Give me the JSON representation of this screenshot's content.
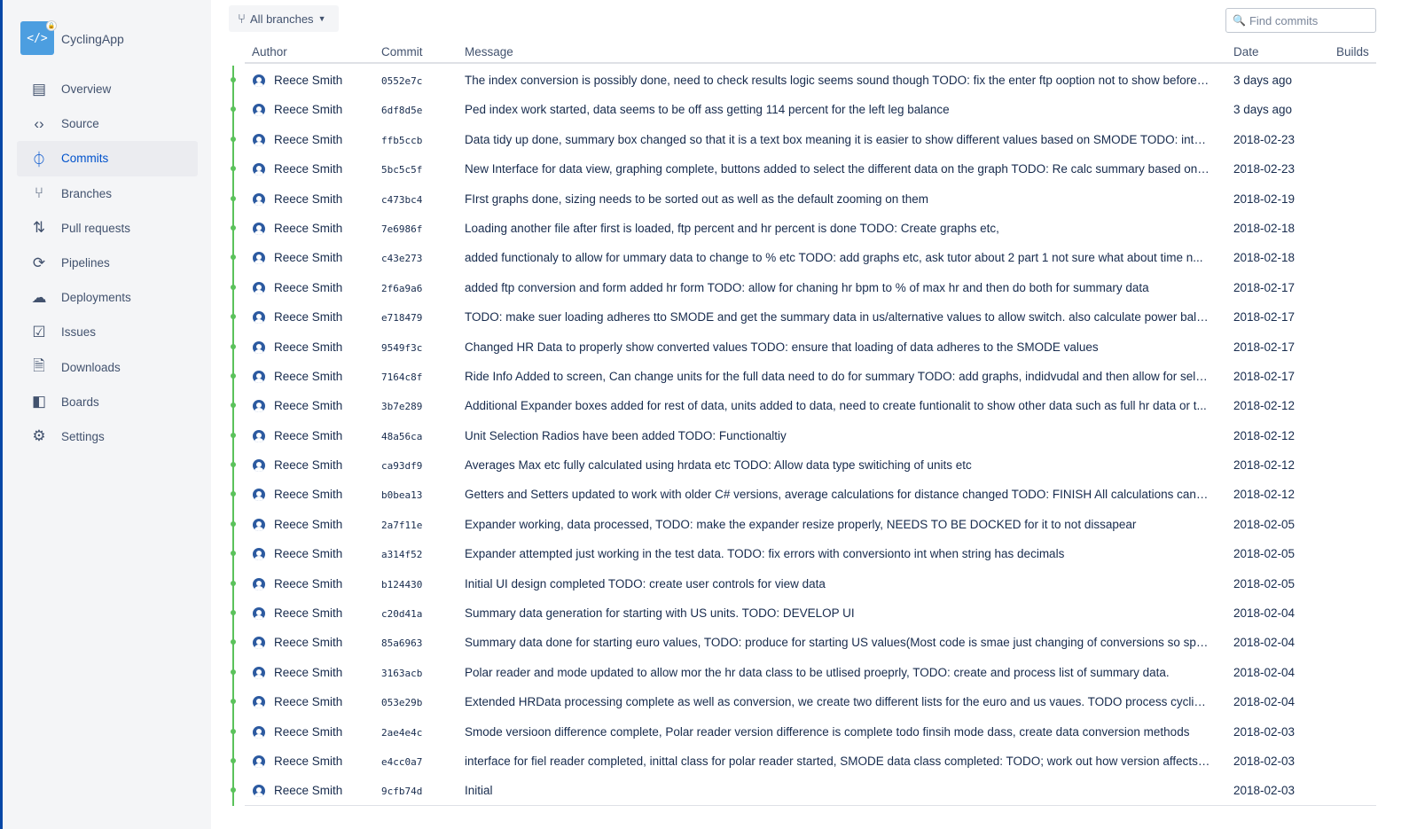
{
  "repo": {
    "name": "CyclingApp",
    "icon": "code-icon",
    "private": true
  },
  "colors": {
    "accent": "#0052cc",
    "graph": "#5bc25b",
    "stripe": "#0747a6"
  },
  "sidebar": {
    "items": [
      {
        "label": "Overview",
        "icon": "overview-icon",
        "glyph": "▤"
      },
      {
        "label": "Source",
        "icon": "source-icon",
        "glyph": "‹›"
      },
      {
        "label": "Commits",
        "icon": "commit-icon",
        "glyph": "⏀",
        "active": true
      },
      {
        "label": "Branches",
        "icon": "branch-icon",
        "glyph": "⑂"
      },
      {
        "label": "Pull requests",
        "icon": "pull-request-icon",
        "glyph": "⇅"
      },
      {
        "label": "Pipelines",
        "icon": "pipelines-icon",
        "glyph": "⟳"
      },
      {
        "label": "Deployments",
        "icon": "deployments-icon",
        "glyph": "☁"
      },
      {
        "label": "Issues",
        "icon": "issues-icon",
        "glyph": "☑"
      },
      {
        "label": "Downloads",
        "icon": "downloads-icon",
        "glyph": "🗎"
      },
      {
        "label": "Boards",
        "icon": "boards-icon",
        "glyph": "◧"
      },
      {
        "label": "Settings",
        "icon": "settings-icon",
        "glyph": "⚙"
      }
    ]
  },
  "toolbar": {
    "branch_label": "All branches",
    "search_placeholder": "Find commits"
  },
  "table": {
    "headers": {
      "author": "Author",
      "commit": "Commit",
      "message": "Message",
      "date": "Date",
      "builds": "Builds"
    },
    "rows": [
      {
        "author": "Reece Smith",
        "hash": "0552e7c",
        "message": "The index conversion is possibly done, need to check results logic seems sound though TODO: fix the enter ftp ooption not to show before t...",
        "date": "3 days ago"
      },
      {
        "author": "Reece Smith",
        "hash": "6df8d5e",
        "message": "Ped index work started, data seems to be off ass getting 114 percent for the left leg balance",
        "date": "3 days ago"
      },
      {
        "author": "Reece Smith",
        "hash": "ffb5ccb",
        "message": "Data tidy up done, summary box changed so that it is a text box meaning it is easier to show different values based on SMODE TODO: inter...",
        "date": "2018-02-23"
      },
      {
        "author": "Reece Smith",
        "hash": "5bc5c5f",
        "message": "New Interface for data view, graphing complete, buttons added to select the different data on the graph TODO: Re calc summary based on s...",
        "date": "2018-02-23"
      },
      {
        "author": "Reece Smith",
        "hash": "c473bc4",
        "message": "FIrst graphs done, sizing needs to be sorted out as well as the default zooming on them",
        "date": "2018-02-19"
      },
      {
        "author": "Reece Smith",
        "hash": "7e6986f",
        "message": "Loading another file after first is loaded, ftp percent and hr percent is done TODO: Create graphs etc,",
        "date": "2018-02-18"
      },
      {
        "author": "Reece Smith",
        "hash": "c43e273",
        "message": "added functionaly to allow for ummary data to change to % etc TODO: add graphs etc, ask tutor about 2 part 1 not sure what about time n...",
        "date": "2018-02-18"
      },
      {
        "author": "Reece Smith",
        "hash": "2f6a9a6",
        "message": "added ftp conversion and form added hr form TODO: allow for chaning hr bpm to % of max hr and then do both for summary data",
        "date": "2018-02-17"
      },
      {
        "author": "Reece Smith",
        "hash": "e718479",
        "message": "TODO: make suer loading adheres tto SMODE and get the summary data in us/alternative values to allow switch. also calculate power balan...",
        "date": "2018-02-17"
      },
      {
        "author": "Reece Smith",
        "hash": "9549f3c",
        "message": "Changed HR Data to properly show converted values TODO: ensure that loading of data adheres to the SMODE values",
        "date": "2018-02-17"
      },
      {
        "author": "Reece Smith",
        "hash": "7164c8f",
        "message": "Ride Info Added to screen, Can change units for the full data need to do for summary TODO: add graphs, indidvudal and then allow for sele...",
        "date": "2018-02-17"
      },
      {
        "author": "Reece Smith",
        "hash": "3b7e289",
        "message": "Additional Expander boxes added for rest of data, units added to data, need to create funtionalit to show other data such as full hr data or t...",
        "date": "2018-02-12"
      },
      {
        "author": "Reece Smith",
        "hash": "48a56ca",
        "message": "Unit Selection Radios have been added TODO: Functionaltiy",
        "date": "2018-02-12"
      },
      {
        "author": "Reece Smith",
        "hash": "ca93df9",
        "message": "Averages Max etc fully calculated using hrdata etc TODO: Allow data type switiching of units etc",
        "date": "2018-02-12"
      },
      {
        "author": "Reece Smith",
        "hash": "b0bea13",
        "message": "Getters and Setters updated to work with older C# versions, average calculations for distance changed TODO: FINISH All calculations cannot...",
        "date": "2018-02-12"
      },
      {
        "author": "Reece Smith",
        "hash": "2a7f11e",
        "message": "Expander working, data processed, TODO: make the expander resize properly, NEEDS TO BE DOCKED for it to not dissapear",
        "date": "2018-02-05"
      },
      {
        "author": "Reece Smith",
        "hash": "a314f52",
        "message": "Expander attempted just working in the test data. TODO: fix errors with conversionto int when string has decimals",
        "date": "2018-02-05"
      },
      {
        "author": "Reece Smith",
        "hash": "b124430",
        "message": "Initial UI design completed TODO: create user controls for view data",
        "date": "2018-02-05"
      },
      {
        "author": "Reece Smith",
        "hash": "c20d41a",
        "message": "Summary data generation for starting with US units. TODO: DEVELOP UI",
        "date": "2018-02-04"
      },
      {
        "author": "Reece Smith",
        "hash": "85a6963",
        "message": "Summary data done for starting euro values, TODO: produce for starting US values(Most code is smae just changing of conversions so spee...",
        "date": "2018-02-04"
      },
      {
        "author": "Reece Smith",
        "hash": "3163acb",
        "message": "Polar reader and mode updated to allow mor the hr data class to be utlised proeprly, TODO: create and process list of summary data.",
        "date": "2018-02-04"
      },
      {
        "author": "Reece Smith",
        "hash": "053e29b",
        "message": "Extended HRData processing complete as well as conversion, we create two different lists for the euro and us vaues. TODO process cycling p...",
        "date": "2018-02-04"
      },
      {
        "author": "Reece Smith",
        "hash": "2ae4e4c",
        "message": "Smode versioon difference complete, Polar reader version difference is complete todo finsih mode dass, create data conversion methods",
        "date": "2018-02-03"
      },
      {
        "author": "Reece Smith",
        "hash": "e4cc0a7",
        "message": "interface for fiel reader completed, inittal class for polar reader started, SMODE data class completed: TODO; work out how version affects w...",
        "date": "2018-02-03"
      },
      {
        "author": "Reece Smith",
        "hash": "9cfb74d",
        "message": "Initial",
        "date": "2018-02-03"
      }
    ]
  }
}
